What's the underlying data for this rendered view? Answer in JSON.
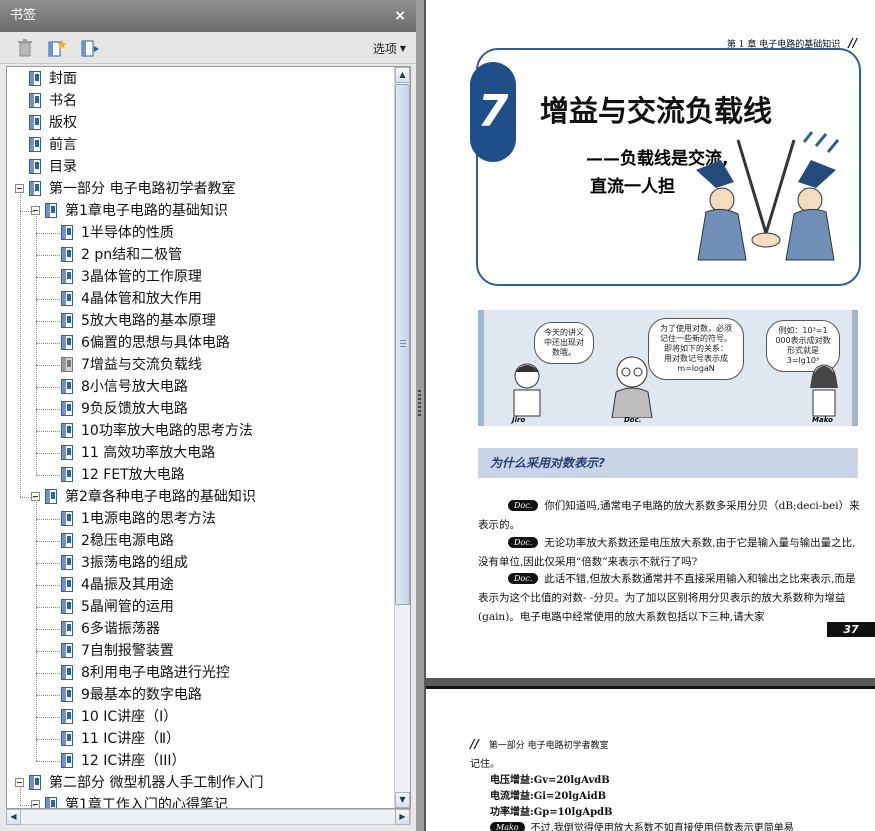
{
  "panel": {
    "title": "书签",
    "close_glyph": "×",
    "options_label": "选项",
    "toolbar_icons": [
      "delete-icon",
      "new-bookmark-icon",
      "expand-bookmark-icon"
    ]
  },
  "tree": [
    {
      "level": 0,
      "label": "封面",
      "expander": false
    },
    {
      "level": 0,
      "label": "书名",
      "expander": false
    },
    {
      "level": 0,
      "label": "版权",
      "expander": false
    },
    {
      "level": 0,
      "label": "前言",
      "expander": false
    },
    {
      "level": 0,
      "label": "目录",
      "expander": false
    },
    {
      "level": 0,
      "label": "第一部分  电子电路初学者教室",
      "expander": true
    },
    {
      "level": 1,
      "label": "第1章电子电路的基础知识",
      "expander": true
    },
    {
      "level": 2,
      "label": "1半导体的性质",
      "expander": false
    },
    {
      "level": 2,
      "label": "2 pn结和二极管",
      "expander": false
    },
    {
      "level": 2,
      "label": "3晶体管的工作原理",
      "expander": false
    },
    {
      "level": 2,
      "label": "4晶体管和放大作用",
      "expander": false
    },
    {
      "level": 2,
      "label": "5放大电路的基本原理",
      "expander": false
    },
    {
      "level": 2,
      "label": "6偏置的思想与具体电路",
      "expander": false
    },
    {
      "level": 2,
      "label": "7增益与交流负载线",
      "expander": false,
      "current": true
    },
    {
      "level": 2,
      "label": "8小信号放大电路",
      "expander": false
    },
    {
      "level": 2,
      "label": "9负反馈放大电路",
      "expander": false
    },
    {
      "level": 2,
      "label": "10功率放大电路的思考方法",
      "expander": false
    },
    {
      "level": 2,
      "label": "11  高效功率放大电路",
      "expander": false
    },
    {
      "level": 2,
      "label": "12  FET放大电路",
      "expander": false
    },
    {
      "level": 1,
      "label": "第2章各种电子电路的基础知识",
      "expander": true
    },
    {
      "level": 2,
      "label": "1电源电路的思考方法",
      "expander": false
    },
    {
      "level": 2,
      "label": "2稳压电源电路",
      "expander": false
    },
    {
      "level": 2,
      "label": "3振荡电路的组成",
      "expander": false
    },
    {
      "level": 2,
      "label": "4晶振及其用途",
      "expander": false
    },
    {
      "level": 2,
      "label": "5晶闸管的运用",
      "expander": false
    },
    {
      "level": 2,
      "label": "6多谐振荡器",
      "expander": false
    },
    {
      "level": 2,
      "label": "7自制报警装置",
      "expander": false
    },
    {
      "level": 2,
      "label": "8利用电子电路进行光控",
      "expander": false
    },
    {
      "level": 2,
      "label": "9最基本的数字电路",
      "expander": false
    },
    {
      "level": 2,
      "label": "10 IC讲座（Ⅰ）",
      "expander": false
    },
    {
      "level": 2,
      "label": "11 IC讲座（Ⅱ）",
      "expander": false
    },
    {
      "level": 2,
      "label": "12 IC讲座（III）",
      "expander": false
    },
    {
      "level": 0,
      "label": "第二部分  微型机器人手工制作入门",
      "expander": true
    },
    {
      "level": 1,
      "label": "第1章工作入门的心得笔记",
      "expander": true
    }
  ],
  "page1": {
    "header_text": "第 1 章  电子电路的基础知识",
    "header_mark": "//",
    "chapter_number": "7",
    "title": "增益与交流负载线",
    "subtitle_line1": "——负载线是交流,",
    "subtitle_line2": "直流一人担",
    "comic": {
      "bubble1": "今天的讲义中还出现对数哦。",
      "bubble2": "为了使用对数，必须记住一些新的符号。即将如下的关系：",
      "bubble2_formula_label": "用对数记号表示成",
      "bubble2_formula": "m=logaN",
      "bubble3": "例如：10³=1 000表示成对数形式就是3=lg10³",
      "names": [
        "Jiro",
        "Doc.",
        "Mako"
      ]
    },
    "section_title": "为什么采用对数表示?",
    "paragraphs": [
      {
        "speaker": "Doc.",
        "text": "你们知道吗,通常电子电路的放大系数多采用分贝（dB;deci-bei）来表示的。"
      },
      {
        "speaker": "Doc.",
        "text": "无论功率放大系数还是电压放大系数,由于它是输入量与输出量之比,没有单位,因此仅采用“倍数”来表示不就行了吗?"
      },
      {
        "speaker": "Doc.",
        "text": "此话不错,但放大系数通常并不直接采用输入和输出之比来表示,而是表示为这个比值的对数-  -分贝。为了加以区别将用分贝表示的放大系数称为增益(gain)。电子电路中经常使用的放大系数包括以下三种,请大家"
      }
    ],
    "page_number": "37"
  },
  "page2": {
    "header_mark": "//",
    "header_text": "第一部分  电子电路初学者教室",
    "line0": "记住。",
    "formulas": [
      "电压增益:Gv=20lgAvdB",
      "电流增益:Gi=20lgAidB",
      "功率增益:Gp=10lgApdB"
    ],
    "speaker": "Mako",
    "last_line": "不过,我倒觉得使用放大系数不如直接使用倍数表示更简单易"
  }
}
